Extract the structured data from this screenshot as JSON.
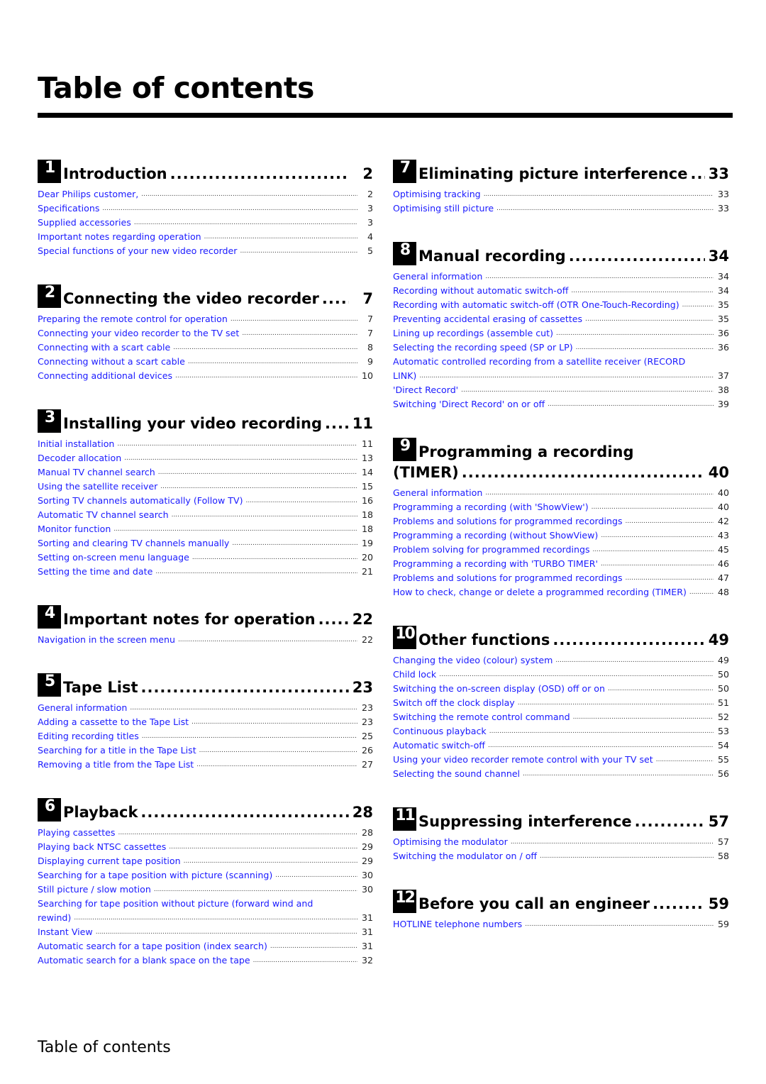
{
  "page": {
    "title": "Table of contents",
    "footer": "Table of contents",
    "link_color": "#1a1aff"
  },
  "left_column": [
    {
      "number": "1",
      "title": "Introduction",
      "page": "2",
      "entries": [
        {
          "text": "Dear Philips customer,",
          "page": "2"
        },
        {
          "text": "Specifications",
          "page": "3"
        },
        {
          "text": "Supplied accessories",
          "page": "3"
        },
        {
          "text": "Important notes regarding operation",
          "page": "4"
        },
        {
          "text": "Special functions of your new video recorder",
          "page": "5"
        }
      ]
    },
    {
      "number": "2",
      "title": "Connecting the video recorder",
      "page": "7",
      "entries": [
        {
          "text": "Preparing the remote control for operation",
          "page": "7"
        },
        {
          "text": "Connecting your video recorder to the TV set",
          "page": "7"
        },
        {
          "text": "Connecting with a scart cable",
          "page": "8"
        },
        {
          "text": "Connecting without a scart cable",
          "page": "9"
        },
        {
          "text": "Connecting additional devices",
          "page": "10"
        }
      ]
    },
    {
      "number": "3",
      "title": "Installing your video recording",
      "page": "11",
      "entries": [
        {
          "text": "Initial installation",
          "page": "11"
        },
        {
          "text": "Decoder allocation",
          "page": "13"
        },
        {
          "text": "Manual TV channel search",
          "page": "14"
        },
        {
          "text": "Using the satellite receiver",
          "page": "15"
        },
        {
          "text": "Sorting TV channels automatically (Follow TV)",
          "page": "16"
        },
        {
          "text": "Automatic TV channel search",
          "page": "18"
        },
        {
          "text": "Monitor function",
          "page": "18"
        },
        {
          "text": "Sorting and clearing TV channels manually",
          "page": "19"
        },
        {
          "text": "Setting on-screen menu language",
          "page": "20"
        },
        {
          "text": "Setting the time and date",
          "page": "21"
        }
      ]
    },
    {
      "number": "4",
      "title": "Important notes for operation",
      "page": "22",
      "entries": [
        {
          "text": "Navigation in the screen menu",
          "page": "22"
        }
      ]
    },
    {
      "number": "5",
      "title": "Tape List",
      "page": "23",
      "entries": [
        {
          "text": "General information",
          "page": "23"
        },
        {
          "text": "Adding a cassette to the Tape List",
          "page": "23"
        },
        {
          "text": "Editing recording titles",
          "page": "25"
        },
        {
          "text": "Searching for a title in the Tape List",
          "page": "26"
        },
        {
          "text": "Removing a title from the Tape List",
          "page": "27"
        }
      ]
    },
    {
      "number": "6",
      "title": "Playback",
      "page": "28",
      "entries": [
        {
          "text": "Playing cassettes",
          "page": "28"
        },
        {
          "text": "Playing back NTSC cassettes",
          "page": "29"
        },
        {
          "text": "Displaying current tape position",
          "page": "29"
        },
        {
          "text": "Searching for a tape position with picture (scanning)",
          "page": "30"
        },
        {
          "text": "Still picture / slow motion",
          "page": "30"
        },
        {
          "text": "Searching for tape position without picture (forward wind and",
          "text2": "rewind)",
          "page": "31"
        },
        {
          "text": "Instant View",
          "page": "31"
        },
        {
          "text": "Automatic search for a tape position (index search)",
          "page": "31"
        },
        {
          "text": "Automatic search for a blank space on the tape",
          "page": "32"
        }
      ]
    }
  ],
  "right_column": [
    {
      "number": "7",
      "title": "Eliminating picture interference",
      "page": "33",
      "entries": [
        {
          "text": "Optimising tracking",
          "page": "33"
        },
        {
          "text": "Optimising still picture",
          "page": "33"
        }
      ]
    },
    {
      "number": "8",
      "title": "Manual recording",
      "page": "34",
      "entries": [
        {
          "text": "General information",
          "page": "34"
        },
        {
          "text": "Recording without automatic switch-off",
          "page": "34"
        },
        {
          "text": "Recording with automatic switch-off (OTR One-Touch-Recording)",
          "page": "35"
        },
        {
          "text": "Preventing accidental erasing of cassettes",
          "page": "35"
        },
        {
          "text": "Lining up recordings (assemble cut)",
          "page": "36"
        },
        {
          "text": "Selecting the recording speed (SP or LP)",
          "page": "36"
        },
        {
          "text": "Automatic controlled recording from a satellite receiver (RECORD",
          "text2": "LINK)",
          "page": "37"
        },
        {
          "text": "'Direct Record'",
          "page": "38"
        },
        {
          "text": "Switching 'Direct Record' on or off",
          "page": "39"
        }
      ]
    },
    {
      "number": "9",
      "title": "Programming a recording",
      "title2": "(TIMER)",
      "page": "40",
      "entries": [
        {
          "text": "General information",
          "page": "40"
        },
        {
          "text": "Programming a recording (with 'ShowView')",
          "page": "40"
        },
        {
          "text": "Problems and solutions for programmed recordings",
          "page": "42"
        },
        {
          "text": "Programming a recording (without ShowView)",
          "page": "43"
        },
        {
          "text": "Problem solving for programmed recordings",
          "page": "45"
        },
        {
          "text": "Programming a recording with 'TURBO TIMER'",
          "page": "46"
        },
        {
          "text": "Problems and solutions for programmed recordings",
          "page": "47"
        },
        {
          "text": "How to check, change or delete a programmed recording (TIMER)",
          "page": "48"
        }
      ]
    },
    {
      "number": "10",
      "title": "Other functions",
      "page": "49",
      "entries": [
        {
          "text": "Changing the video (colour) system",
          "page": "49"
        },
        {
          "text": "Child lock",
          "page": "50"
        },
        {
          "text": "Switching the on-screen display (OSD) off or on",
          "page": "50"
        },
        {
          "text": "Switch off the clock display",
          "page": "51"
        },
        {
          "text": "Switching the remote control command",
          "page": "52"
        },
        {
          "text": "Continuous playback",
          "page": "53"
        },
        {
          "text": "Automatic switch-off",
          "page": "54"
        },
        {
          "text": "Using your video recorder remote control with your TV set",
          "page": "55"
        },
        {
          "text": "Selecting the sound channel",
          "page": "56"
        }
      ]
    },
    {
      "number": "11",
      "title": "Suppressing interference",
      "page": "57",
      "entries": [
        {
          "text": "Optimising the modulator",
          "page": "57"
        },
        {
          "text": "Switching the modulator on / off",
          "page": "58"
        }
      ]
    },
    {
      "number": "12",
      "title": "Before you call an engineer",
      "page": "59",
      "entries": [
        {
          "text": "HOTLINE telephone numbers",
          "page": "59"
        }
      ]
    }
  ]
}
